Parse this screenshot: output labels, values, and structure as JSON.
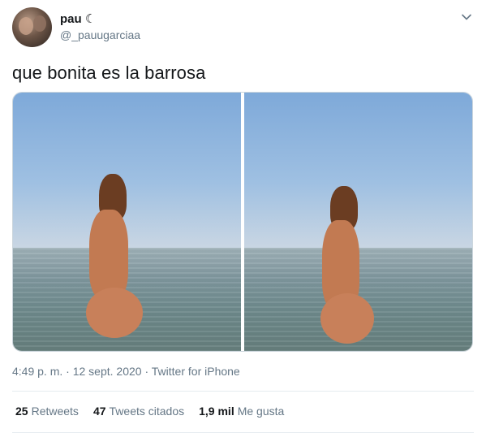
{
  "user": {
    "name": "pau ☾",
    "handle": "@_pauugarciaa"
  },
  "tweet": {
    "text": "que bonita es la barrosa",
    "time": "4:49 p. m.",
    "date": "12 sept. 2020",
    "separator": "·",
    "source": "Twitter for iPhone"
  },
  "stats": [
    {
      "count": "25",
      "label": "Retweets"
    },
    {
      "count": "47",
      "label": "Tweets citados"
    },
    {
      "count": "1,9 mil",
      "label": "Me gusta"
    }
  ],
  "icons": {
    "caret": "chevron-down-icon"
  },
  "colors": {
    "text_primary": "#14171a",
    "text_secondary": "#657786",
    "divider": "#e6ecf0"
  }
}
